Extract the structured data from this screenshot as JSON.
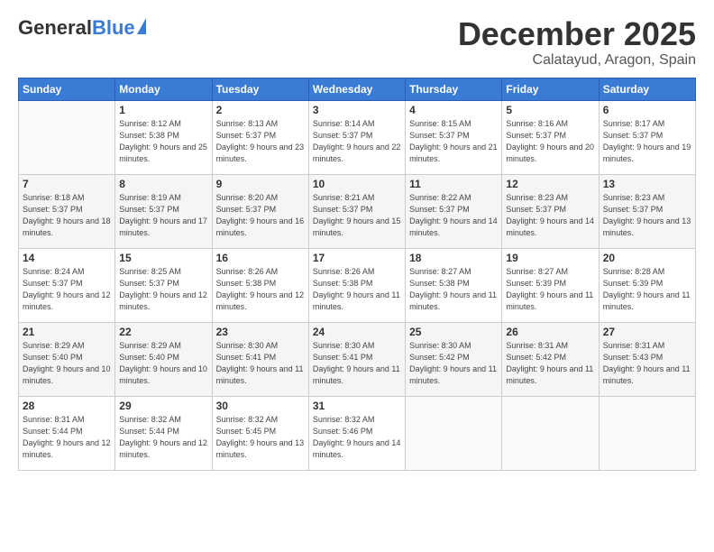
{
  "header": {
    "logo_general": "General",
    "logo_blue": "Blue",
    "month_title": "December 2025",
    "location": "Calatayud, Aragon, Spain"
  },
  "weekdays": [
    "Sunday",
    "Monday",
    "Tuesday",
    "Wednesday",
    "Thursday",
    "Friday",
    "Saturday"
  ],
  "weeks": [
    [
      {
        "day": "",
        "info": ""
      },
      {
        "day": "1",
        "info": "Sunrise: 8:12 AM\nSunset: 5:38 PM\nDaylight: 9 hours\nand 25 minutes."
      },
      {
        "day": "2",
        "info": "Sunrise: 8:13 AM\nSunset: 5:37 PM\nDaylight: 9 hours\nand 23 minutes."
      },
      {
        "day": "3",
        "info": "Sunrise: 8:14 AM\nSunset: 5:37 PM\nDaylight: 9 hours\nand 22 minutes."
      },
      {
        "day": "4",
        "info": "Sunrise: 8:15 AM\nSunset: 5:37 PM\nDaylight: 9 hours\nand 21 minutes."
      },
      {
        "day": "5",
        "info": "Sunrise: 8:16 AM\nSunset: 5:37 PM\nDaylight: 9 hours\nand 20 minutes."
      },
      {
        "day": "6",
        "info": "Sunrise: 8:17 AM\nSunset: 5:37 PM\nDaylight: 9 hours\nand 19 minutes."
      }
    ],
    [
      {
        "day": "7",
        "info": "Sunrise: 8:18 AM\nSunset: 5:37 PM\nDaylight: 9 hours\nand 18 minutes."
      },
      {
        "day": "8",
        "info": "Sunrise: 8:19 AM\nSunset: 5:37 PM\nDaylight: 9 hours\nand 17 minutes."
      },
      {
        "day": "9",
        "info": "Sunrise: 8:20 AM\nSunset: 5:37 PM\nDaylight: 9 hours\nand 16 minutes."
      },
      {
        "day": "10",
        "info": "Sunrise: 8:21 AM\nSunset: 5:37 PM\nDaylight: 9 hours\nand 15 minutes."
      },
      {
        "day": "11",
        "info": "Sunrise: 8:22 AM\nSunset: 5:37 PM\nDaylight: 9 hours\nand 14 minutes."
      },
      {
        "day": "12",
        "info": "Sunrise: 8:23 AM\nSunset: 5:37 PM\nDaylight: 9 hours\nand 14 minutes."
      },
      {
        "day": "13",
        "info": "Sunrise: 8:23 AM\nSunset: 5:37 PM\nDaylight: 9 hours\nand 13 minutes."
      }
    ],
    [
      {
        "day": "14",
        "info": "Sunrise: 8:24 AM\nSunset: 5:37 PM\nDaylight: 9 hours\nand 12 minutes."
      },
      {
        "day": "15",
        "info": "Sunrise: 8:25 AM\nSunset: 5:37 PM\nDaylight: 9 hours\nand 12 minutes."
      },
      {
        "day": "16",
        "info": "Sunrise: 8:26 AM\nSunset: 5:38 PM\nDaylight: 9 hours\nand 12 minutes."
      },
      {
        "day": "17",
        "info": "Sunrise: 8:26 AM\nSunset: 5:38 PM\nDaylight: 9 hours\nand 11 minutes."
      },
      {
        "day": "18",
        "info": "Sunrise: 8:27 AM\nSunset: 5:38 PM\nDaylight: 9 hours\nand 11 minutes."
      },
      {
        "day": "19",
        "info": "Sunrise: 8:27 AM\nSunset: 5:39 PM\nDaylight: 9 hours\nand 11 minutes."
      },
      {
        "day": "20",
        "info": "Sunrise: 8:28 AM\nSunset: 5:39 PM\nDaylight: 9 hours\nand 11 minutes."
      }
    ],
    [
      {
        "day": "21",
        "info": "Sunrise: 8:29 AM\nSunset: 5:40 PM\nDaylight: 9 hours\nand 10 minutes."
      },
      {
        "day": "22",
        "info": "Sunrise: 8:29 AM\nSunset: 5:40 PM\nDaylight: 9 hours\nand 10 minutes."
      },
      {
        "day": "23",
        "info": "Sunrise: 8:30 AM\nSunset: 5:41 PM\nDaylight: 9 hours\nand 11 minutes."
      },
      {
        "day": "24",
        "info": "Sunrise: 8:30 AM\nSunset: 5:41 PM\nDaylight: 9 hours\nand 11 minutes."
      },
      {
        "day": "25",
        "info": "Sunrise: 8:30 AM\nSunset: 5:42 PM\nDaylight: 9 hours\nand 11 minutes."
      },
      {
        "day": "26",
        "info": "Sunrise: 8:31 AM\nSunset: 5:42 PM\nDaylight: 9 hours\nand 11 minutes."
      },
      {
        "day": "27",
        "info": "Sunrise: 8:31 AM\nSunset: 5:43 PM\nDaylight: 9 hours\nand 11 minutes."
      }
    ],
    [
      {
        "day": "28",
        "info": "Sunrise: 8:31 AM\nSunset: 5:44 PM\nDaylight: 9 hours\nand 12 minutes."
      },
      {
        "day": "29",
        "info": "Sunrise: 8:32 AM\nSunset: 5:44 PM\nDaylight: 9 hours\nand 12 minutes."
      },
      {
        "day": "30",
        "info": "Sunrise: 8:32 AM\nSunset: 5:45 PM\nDaylight: 9 hours\nand 13 minutes."
      },
      {
        "day": "31",
        "info": "Sunrise: 8:32 AM\nSunset: 5:46 PM\nDaylight: 9 hours\nand 14 minutes."
      },
      {
        "day": "",
        "info": ""
      },
      {
        "day": "",
        "info": ""
      },
      {
        "day": "",
        "info": ""
      }
    ]
  ]
}
